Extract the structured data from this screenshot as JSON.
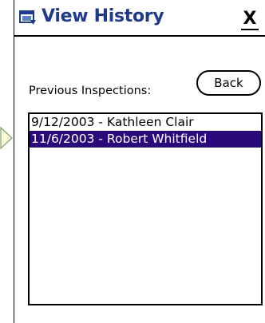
{
  "window": {
    "title": "View History",
    "close_label": "X",
    "icon": "window-icon"
  },
  "inspections": {
    "label": "Previous Inspections:",
    "back_label": "Back",
    "items": [
      {
        "label": "9/12/2003 - Kathleen Clair",
        "selected": false
      },
      {
        "label": "11/6/2003 - Robert Whitfield",
        "selected": true
      }
    ]
  },
  "colors": {
    "title_text": "#1f3a8a",
    "selection": "#2a0a7a"
  }
}
